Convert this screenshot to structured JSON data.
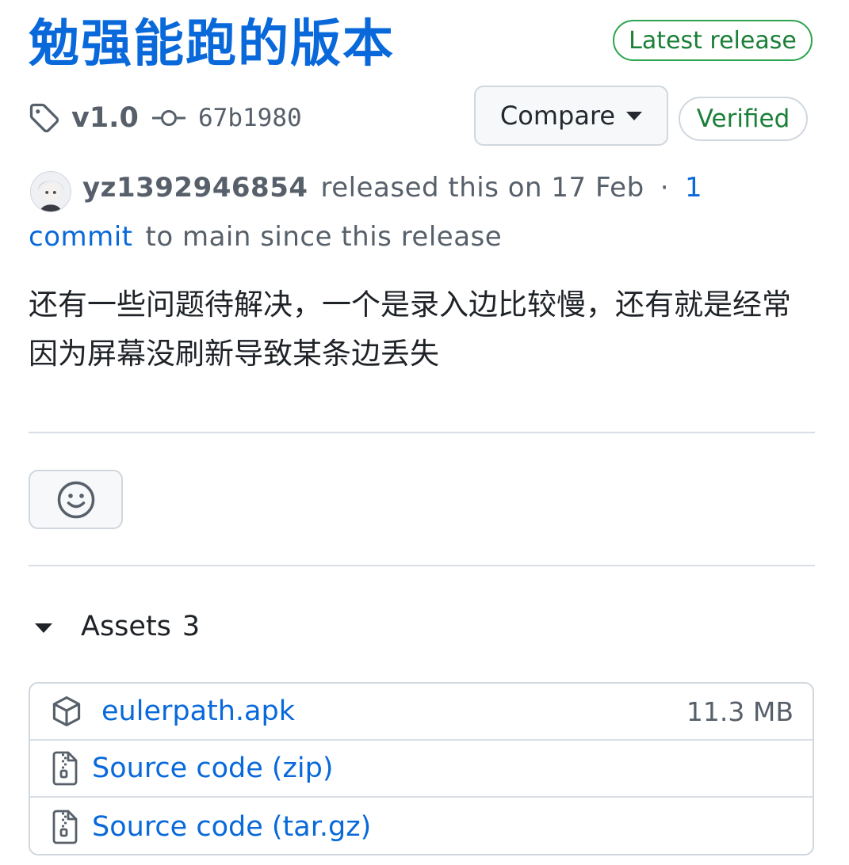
{
  "release": {
    "title": "勉强能跑的版本",
    "latest_badge": "Latest release",
    "tag": "v1.0",
    "commit": "67b1980",
    "compare_label": "Compare",
    "verified_badge": "Verified",
    "author": "yz1392946854",
    "released_text": "released this on 17 Feb",
    "separator": "·",
    "commits_count": "1",
    "commit_word": "commit",
    "since_text": "to main since this release",
    "body": "还有一些问题待解决，一个是录入边比较慢，还有就是经常因为屏幕没刷新导致某条边丢失"
  },
  "assets": {
    "label": "Assets",
    "count": "3",
    "items": [
      {
        "name": "eulerpath.apk",
        "size": "11.3 MB",
        "icon": "package-icon"
      },
      {
        "name": "Source code (zip)",
        "size": "",
        "icon": "file-zip-icon"
      },
      {
        "name": "Source code (tar.gz)",
        "size": "",
        "icon": "file-zip-icon"
      }
    ]
  },
  "colors": {
    "link": "#0969da",
    "success": "#1a7f37",
    "border": "#d0d7de",
    "muted": "#57606a"
  }
}
